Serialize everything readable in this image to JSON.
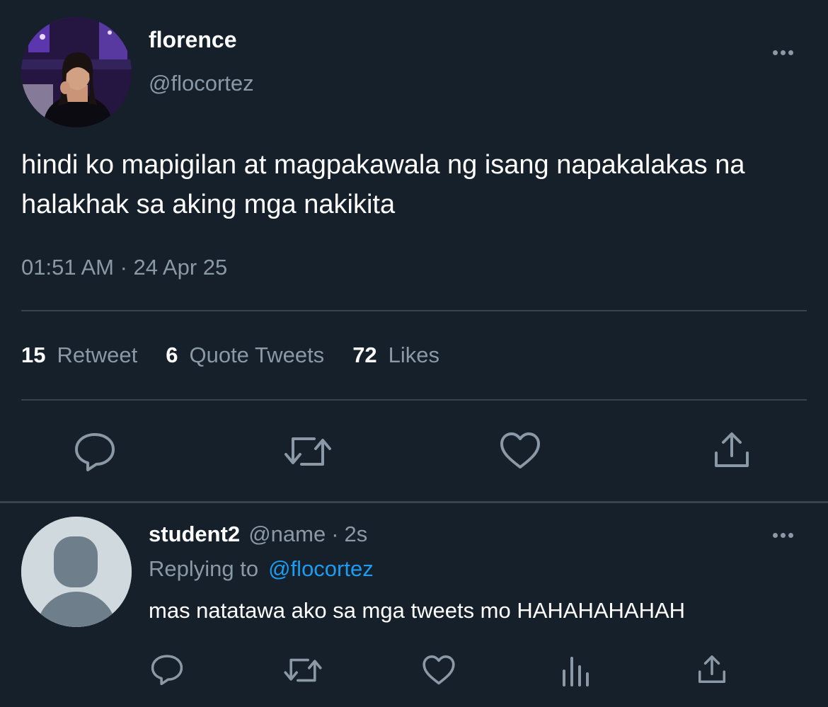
{
  "tweet": {
    "author": {
      "display_name": "florence",
      "handle": "@flocortez",
      "avatar_icon": "profile-photo"
    },
    "text": "hindi ko mapigilan at magpakawala ng isang napakalakas na halakhak sa aking mga nakikita",
    "timestamp": "01:51 AM · 24 Apr 25",
    "stats": {
      "retweets": {
        "count": "15",
        "label": "Retweet"
      },
      "quotes": {
        "count": "6",
        "label": "Quote Tweets"
      },
      "likes": {
        "count": "72",
        "label": "Likes"
      }
    },
    "actions": [
      "reply-icon",
      "retweet-icon",
      "like-icon",
      "share-icon"
    ]
  },
  "reply": {
    "author": {
      "display_name": "student2",
      "handle": "@name",
      "separator": "·",
      "time": "2s",
      "avatar_icon": "default-avatar"
    },
    "replying_label": "Replying to",
    "replying_to": "@flocortez",
    "text": "mas natatawa ako sa mga tweets mo HAHAHAHAHAH",
    "actions": [
      "reply-icon",
      "retweet-icon",
      "like-icon",
      "analytics-icon",
      "share-icon"
    ]
  },
  "colors": {
    "background": "#15202b",
    "secondary_text": "#8b98a5",
    "divider": "#38444d",
    "link": "#1d9bf0"
  }
}
